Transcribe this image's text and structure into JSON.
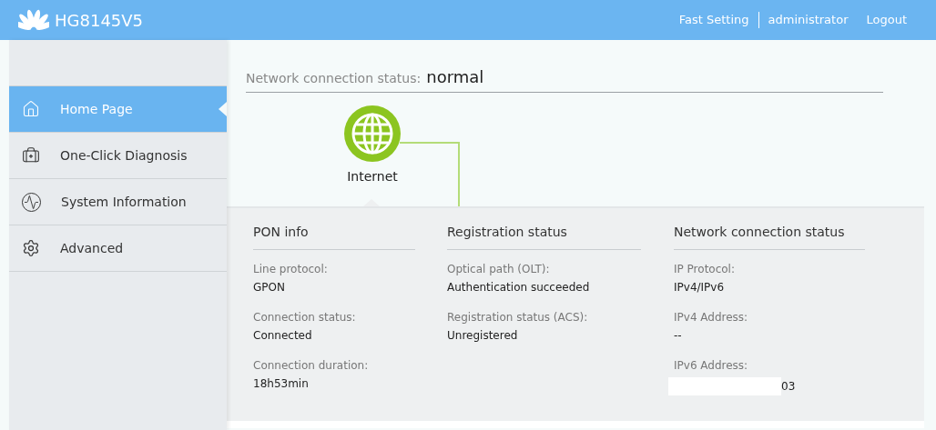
{
  "header": {
    "model": "HG8145V5",
    "links": [
      "Fast Setting",
      "administrator",
      "Logout"
    ]
  },
  "sidebar": {
    "items": [
      {
        "kind": "home",
        "label": "Home Page",
        "selected": true
      },
      {
        "kind": "diagnosis",
        "label": "One-Click Diagnosis",
        "selected": false
      },
      {
        "kind": "system",
        "label": "System Information",
        "selected": false
      },
      {
        "kind": "advanced",
        "label": "Advanced",
        "selected": false
      }
    ]
  },
  "status": {
    "label": "Network connection status:",
    "value": "normal"
  },
  "topology": {
    "node": "Internet"
  },
  "panels": [
    {
      "title": "PON info",
      "fields": [
        {
          "label": "Line protocol:",
          "value": "GPON"
        },
        {
          "label": "Connection status:",
          "value": "Connected"
        },
        {
          "label": "Connection duration:",
          "value": "18h53min"
        }
      ]
    },
    {
      "title": "Registration status",
      "fields": [
        {
          "label": "Optical path (OLT):",
          "value": "Authentication succeeded"
        },
        {
          "label": "Registration status (ACS):",
          "value": "Unregistered"
        }
      ]
    },
    {
      "title": "Network connection status",
      "fields": [
        {
          "label": "IP Protocol:",
          "value": "IPv4/IPv6"
        },
        {
          "label": "IPv4 Address:",
          "value": "--"
        },
        {
          "label": "IPv6 Address:",
          "value": "03",
          "redacted": true
        }
      ]
    }
  ]
}
